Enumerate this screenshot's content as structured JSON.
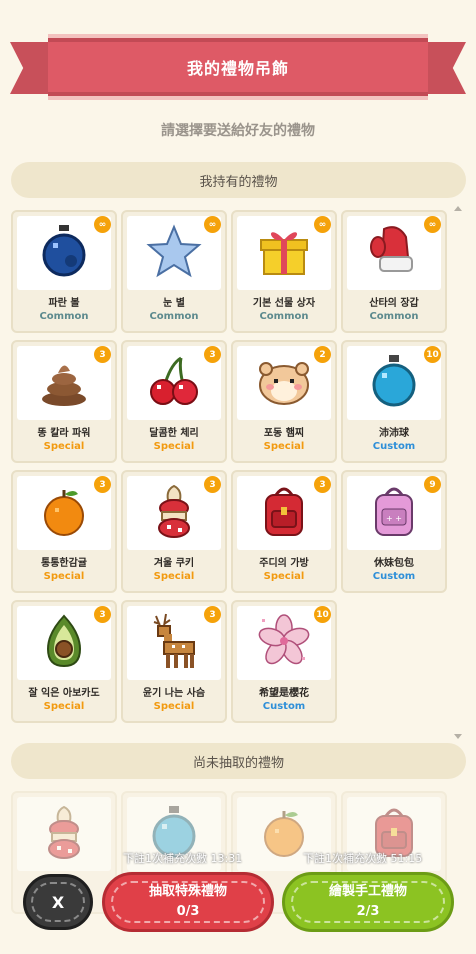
{
  "header": {
    "title": "我的禮物吊飾"
  },
  "subtitle": "請選擇要送給好友的禮物",
  "owned_section": {
    "title": "我持有的禮物"
  },
  "owned_gifts": [
    {
      "name": "파란 볼",
      "rarity": "Common",
      "count": "∞",
      "icon": "blue-ornament-icon"
    },
    {
      "name": "눈 별",
      "rarity": "Common",
      "count": "∞",
      "icon": "star-icon"
    },
    {
      "name": "기본 선물 상자",
      "rarity": "Common",
      "count": "∞",
      "icon": "gift-box-icon"
    },
    {
      "name": "산타의 장갑",
      "rarity": "Common",
      "count": "∞",
      "icon": "mitten-icon"
    },
    {
      "name": "똥 칼라 파워",
      "rarity": "Special",
      "count": "3",
      "icon": "poop-icon"
    },
    {
      "name": "달콤한 체리",
      "rarity": "Special",
      "count": "3",
      "icon": "cherry-icon"
    },
    {
      "name": "포동 햄찌",
      "rarity": "Special",
      "count": "2",
      "icon": "hamster-icon"
    },
    {
      "name": "沛沛球",
      "rarity": "Custom",
      "count": "10",
      "icon": "teal-ornament-icon"
    },
    {
      "name": "통통한감귤",
      "rarity": "Special",
      "count": "3",
      "icon": "tangerine-icon"
    },
    {
      "name": "겨울 쿠키",
      "rarity": "Special",
      "count": "3",
      "icon": "cookie-icon"
    },
    {
      "name": "주디의 가방",
      "rarity": "Special",
      "count": "3",
      "icon": "red-bag-icon"
    },
    {
      "name": "休妹包包",
      "rarity": "Custom",
      "count": "9",
      "icon": "pink-bag-icon"
    },
    {
      "name": "잘 익은 아보카도",
      "rarity": "Special",
      "count": "3",
      "icon": "avocado-icon"
    },
    {
      "name": "윤기 나는 사슴",
      "rarity": "Special",
      "count": "3",
      "icon": "deer-icon"
    },
    {
      "name": "希望是櫻花",
      "rarity": "Custom",
      "count": "10",
      "icon": "sakura-icon"
    }
  ],
  "undrawn_section": {
    "title": "尚未抽取的禮物"
  },
  "timers": [
    "下註1次補充次數 13:31",
    "下註1次補充次數 51:15"
  ],
  "actions": {
    "close_label": "X",
    "special_label": "抽取特殊禮物",
    "special_count": "0/3",
    "custom_label": "繪製手工禮物",
    "custom_count": "2/3"
  },
  "colors": {
    "common": "#5d8a8e",
    "special": "#f29a10",
    "custom": "#2f8fd8",
    "badge": "#f5a20a",
    "banner": "#de5a66"
  }
}
